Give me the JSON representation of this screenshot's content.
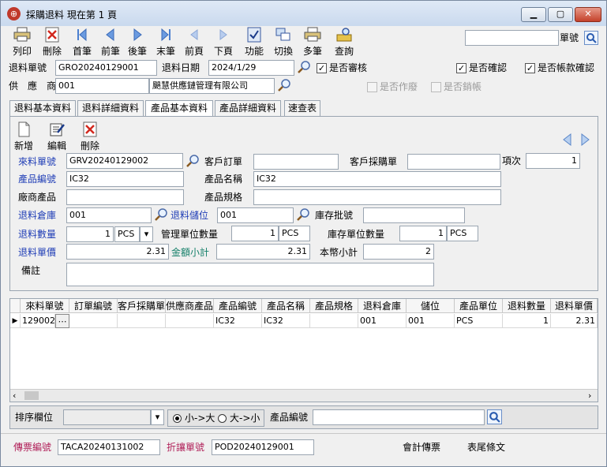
{
  "window": {
    "title": "採購退料  現在第 1 頁"
  },
  "toolbar": {
    "items": [
      {
        "label": "列印",
        "icon": "printer-icon"
      },
      {
        "label": "刪除",
        "icon": "delete-icon"
      },
      {
        "label": "首筆",
        "icon": "first-icon"
      },
      {
        "label": "前筆",
        "icon": "prev-icon"
      },
      {
        "label": "後筆",
        "icon": "next-icon"
      },
      {
        "label": "末筆",
        "icon": "last-icon"
      },
      {
        "label": "前頁",
        "icon": "prev-page-icon"
      },
      {
        "label": "下頁",
        "icon": "next-page-icon"
      },
      {
        "label": "功能",
        "icon": "function-icon"
      },
      {
        "label": "切換",
        "icon": "switch-icon"
      },
      {
        "label": "多筆",
        "icon": "multi-icon"
      },
      {
        "label": "查詢",
        "icon": "query-icon"
      }
    ],
    "search_label": "單號",
    "search_value": ""
  },
  "header": {
    "return_no_label": "退料單號",
    "return_no": "GRO20240129001",
    "return_date_label": "退料日期",
    "return_date": "2024/1/29",
    "reviewed_label": "是否審核",
    "confirmed_label": "是否確認",
    "account_confirmed_label": "是否帳款確認",
    "supplier_label": "供　應　商",
    "supplier_code": "001",
    "supplier_name": "颶慧供應鏈管理有限公司",
    "voided_label": "是否作廢",
    "closed_label": "是否銷帳"
  },
  "tabs": [
    "退料基本資料",
    "退料詳細資料",
    "產品基本資料",
    "產品詳細資料",
    "速查表"
  ],
  "actions": {
    "add": "新增",
    "edit": "編輯",
    "delete": "刪除"
  },
  "detail": {
    "source_no_label": "來料單號",
    "source_no": "GRV20240129002",
    "customer_order_label": "客戶訂單",
    "customer_order": "",
    "customer_po_label": "客戶採購單",
    "customer_po": "",
    "item_no_label": "項次",
    "item_no": "1",
    "product_code_label": "產品編號",
    "product_code": "IC32",
    "product_name_label": "產品名稱",
    "product_name": "IC32",
    "vendor_product_label": "廠商產品",
    "vendor_product": "",
    "product_spec_label": "產品規格",
    "product_spec": "",
    "warehouse_label": "退料倉庫",
    "warehouse": "001",
    "location_label": "退料儲位",
    "location": "001",
    "lot_label": "庫存批號",
    "lot": "",
    "qty_label": "退料數量",
    "qty": "1",
    "qty_unit": "PCS",
    "mgmt_qty_label": "管理單位數量",
    "mgmt_qty": "1",
    "mgmt_unit": "PCS",
    "stock_qty_label": "庫存單位數量",
    "stock_qty": "1",
    "stock_unit": "PCS",
    "price_label": "退料單價",
    "price": "2.31",
    "amount_label": "金額小計",
    "amount": "2.31",
    "local_amount_label": "本幣小計",
    "local_amount": "2",
    "note_label": "備註",
    "note": ""
  },
  "grid": {
    "columns": [
      "來料單號",
      "訂單編號",
      "客戶採購單",
      "供應商產品",
      "產品編號",
      "產品名稱",
      "產品規格",
      "退料倉庫",
      "儲位",
      "產品單位",
      "退料數量",
      "退料單價"
    ],
    "rows": [
      [
        "129002",
        "",
        "",
        "",
        "IC32",
        "IC32",
        "",
        "001",
        "001",
        "PCS",
        "1",
        "2.31"
      ]
    ]
  },
  "sortbar": {
    "sort_label": "排序欄位",
    "sort_value": "",
    "asc_label": "小->大",
    "desc_label": "大->小",
    "filter_label": "產品編號",
    "filter_value": ""
  },
  "footer": {
    "invoice_label": "傳票編號",
    "invoice_no": "TACA20240131002",
    "discount_label": "折讓單號",
    "discount_no": "POD20240129001",
    "accounting_label": "會計傳票",
    "footer_text_label": "表尾條文"
  }
}
